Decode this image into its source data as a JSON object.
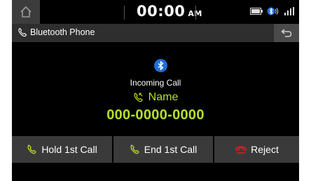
{
  "status_bar": {
    "home_icon": "home-icon",
    "time": "00:00",
    "ampm": "AM",
    "icons": [
      "battery-icon",
      "bluetooth-audio-icon",
      "signal-icon"
    ]
  },
  "title_bar": {
    "title": "Bluetooth Phone",
    "title_icon": "phone-handset-icon",
    "back_icon": "back-arrow-icon"
  },
  "call": {
    "status": "Incoming Call",
    "name": "Name",
    "number": "000-0000-0000"
  },
  "buttons": {
    "hold": "Hold 1st Call",
    "end": "End 1st Call",
    "reject": "Reject"
  },
  "colors": {
    "accent_green": "#b6e02c",
    "reject_red": "#e02020",
    "bluetooth_blue": "#1e6fd8"
  }
}
